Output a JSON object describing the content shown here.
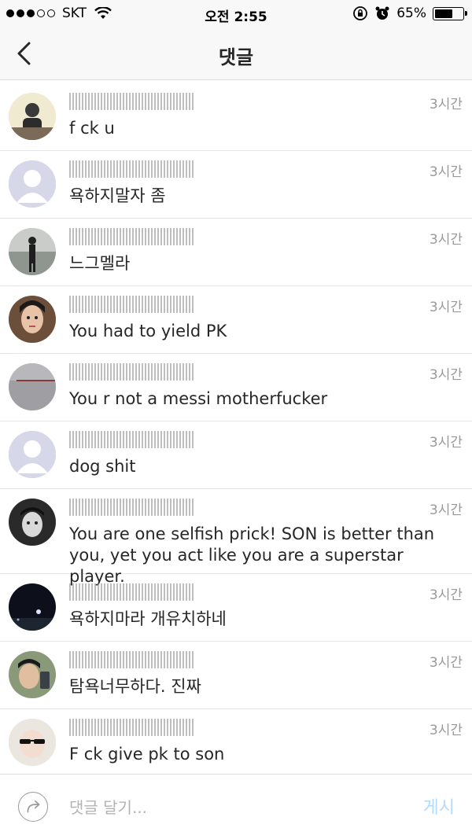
{
  "status_bar": {
    "carrier": "SKT",
    "time": "오전 2:55",
    "battery_percent": "65%",
    "battery_level": 0.65,
    "signal_bars_filled": 3,
    "signal_bars_total": 5
  },
  "nav": {
    "title": "댓글",
    "back_icon": "chevron-left-icon"
  },
  "comments": [
    {
      "text": "f ck u",
      "time": "3시간"
    },
    {
      "text": "욕하지말자 좀",
      "time": "3시간"
    },
    {
      "text": "느그멜라",
      "time": "3시간"
    },
    {
      "text": "You had to yield PK",
      "time": "3시간"
    },
    {
      "text": "You r not a messi motherfucker",
      "time": "3시간"
    },
    {
      "text": "dog shit",
      "time": "3시간"
    },
    {
      "text": "You are one selfish prick! SON is better than you, yet you act like you are a superstar player.",
      "time": "3시간"
    },
    {
      "text": "욕하지마라 개유치하네",
      "time": "3시간"
    },
    {
      "text": "탐욕너무하다. 진짜",
      "time": "3시간"
    },
    {
      "text": "F ck give pk to son",
      "time": "3시간"
    }
  ],
  "input": {
    "placeholder": "댓글 달기...",
    "value": "",
    "post_label": "게시"
  },
  "colors": {
    "bar_background": "#f8f8f8",
    "timestamp": "#999999",
    "post_disabled": "#b3dbff"
  }
}
